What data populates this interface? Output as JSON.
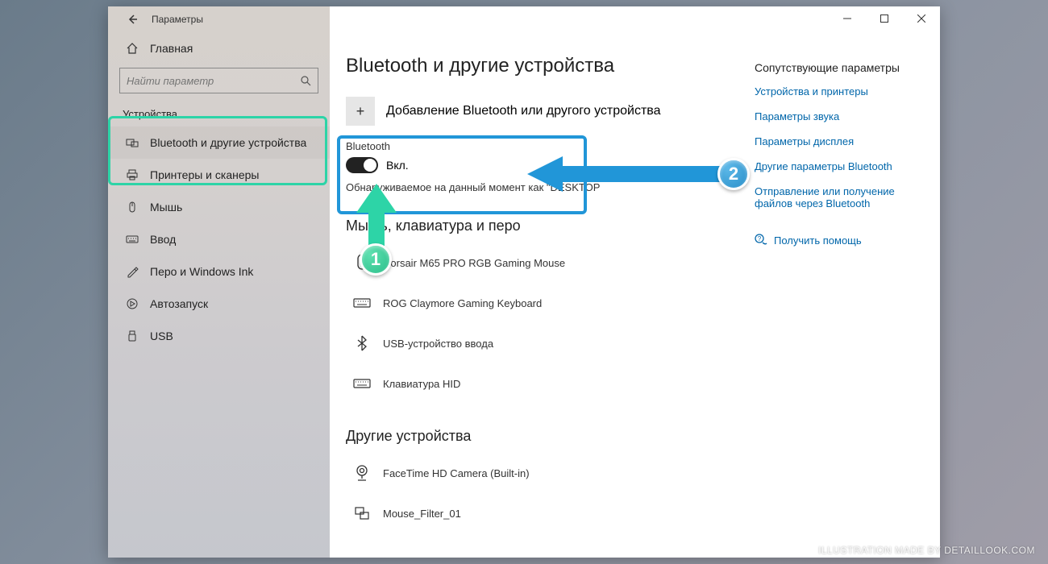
{
  "window": {
    "title": "Параметры"
  },
  "sidebar": {
    "home": "Главная",
    "search_placeholder": "Найти параметр",
    "section": "Устройства",
    "items": [
      {
        "label": "Bluetooth и другие устройства"
      },
      {
        "label": "Принтеры и сканеры"
      },
      {
        "label": "Мышь"
      },
      {
        "label": "Ввод"
      },
      {
        "label": "Перо и Windows Ink"
      },
      {
        "label": "Автозапуск"
      },
      {
        "label": "USB"
      }
    ]
  },
  "main": {
    "title": "Bluetooth и другие устройства",
    "add_device": "Добавление Bluetooth или другого устройства",
    "bt_label": "Bluetooth",
    "bt_state": "Вкл.",
    "discoverable": "Обнаруживаемое на данный момент как \"DESKTOP",
    "section_mouse": "Мышь, клавиатура и перо",
    "devices_mouse": [
      {
        "name": "Corsair M65 PRO RGB Gaming Mouse"
      },
      {
        "name": "ROG Claymore Gaming Keyboard"
      },
      {
        "name": "USB-устройство ввода"
      },
      {
        "name": "Клавиатура HID"
      }
    ],
    "section_other": "Другие устройства",
    "devices_other": [
      {
        "name": "FaceTime HD Camera (Built-in)"
      },
      {
        "name": "Mouse_Filter_01"
      }
    ]
  },
  "right": {
    "title": "Сопутствующие параметры",
    "links": [
      "Устройства и принтеры",
      "Параметры звука",
      "Параметры дисплея",
      "Другие параметры Bluetooth",
      "Отправление или получение файлов через Bluetooth"
    ],
    "help": "Получить помощь"
  },
  "annotations": {
    "badge1": "1",
    "badge2": "2"
  },
  "watermark": "ILLUSTRATION MADE BY DETAILLOOK.COM"
}
